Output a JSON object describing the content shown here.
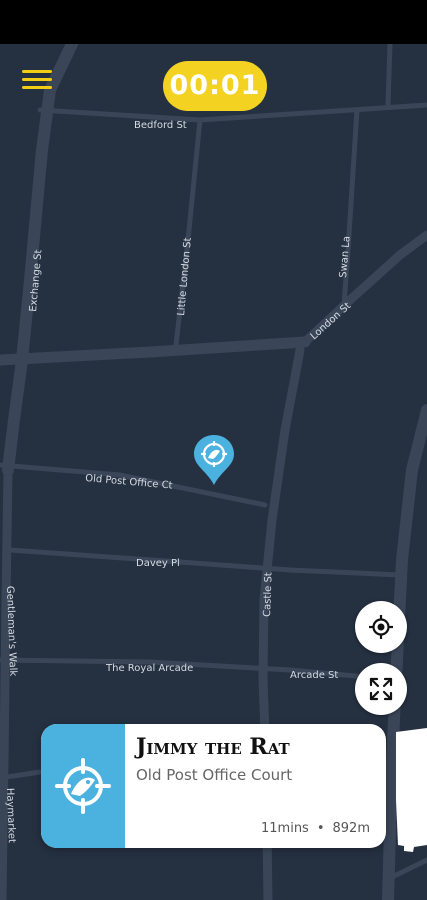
{
  "timer": {
    "text": "00:01"
  },
  "map": {
    "streets": [
      "Bedford St",
      "Exchange St",
      "Little London St",
      "Swan La",
      "London St",
      "Old Post Office Ct",
      "Davey Pl",
      "Castle St",
      "Gentleman's Walk",
      "The Royal Arcade",
      "Arcade St",
      "Haymarket"
    ]
  },
  "location_card": {
    "title": "Jimmy the Rat",
    "subtitle": "Old Post Office Court",
    "duration": "11mins",
    "separator": "•",
    "distance": "892m"
  },
  "icons": {
    "menu": "hamburger-menu-icon",
    "locate": "crosshair-locate-icon",
    "expand": "expand-arrows-icon",
    "rat": "rat-crosshair-icon"
  },
  "colors": {
    "map_background": "#253041",
    "road": "#3a4658",
    "accent_yellow": "#f4d221",
    "marker_blue": "#4bb2e0"
  }
}
